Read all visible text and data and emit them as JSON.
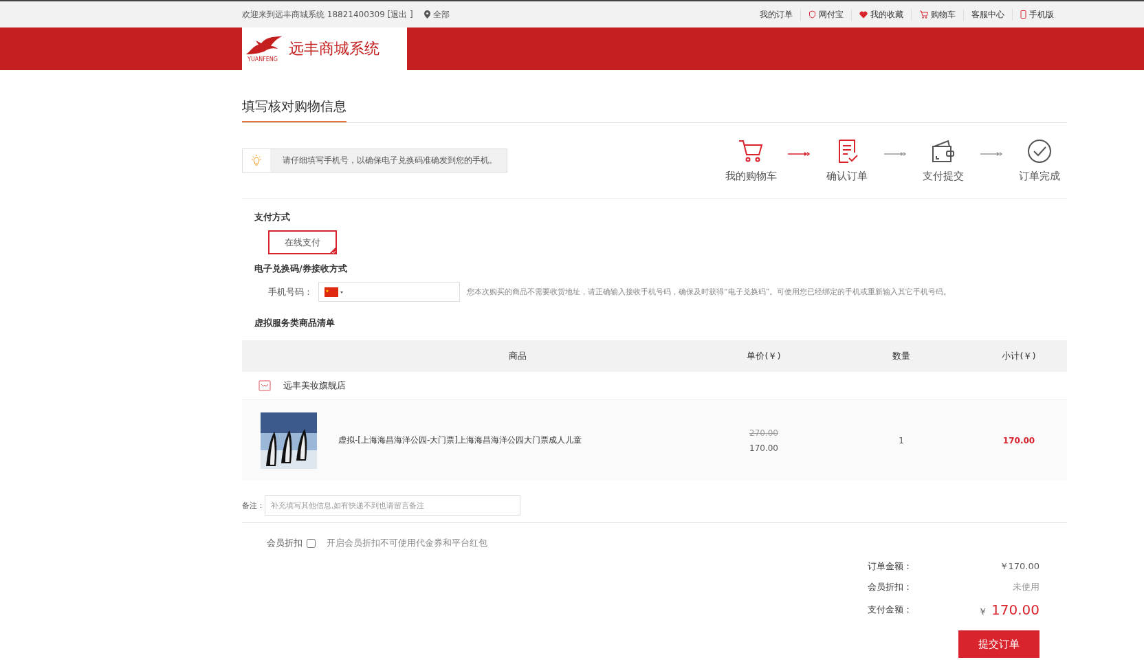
{
  "topbar": {
    "welcome": "欢迎来到远丰商城系统 18821400309 [退出 ]",
    "location": "全部",
    "links": [
      {
        "label": "我的订单",
        "kind": "plain"
      },
      {
        "label": "网付宝",
        "kind": "wallet"
      },
      {
        "label": "我的收藏",
        "kind": "favorites"
      },
      {
        "label": "购物车",
        "kind": "cart"
      },
      {
        "label": "客服中心",
        "kind": "plain"
      },
      {
        "label": "手机版",
        "kind": "mobile"
      }
    ]
  },
  "header": {
    "logo_text": "远丰商城系统",
    "logo_sub": "YUANFENG"
  },
  "page_title": "填写核对购物信息",
  "notice": "请仔细填写手机号，以确保电子兑换码准确发到您的手机。",
  "steps": [
    {
      "label": "我的购物车",
      "kind": "cart",
      "active": true
    },
    {
      "label": "确认订单",
      "kind": "confirm",
      "active": true
    },
    {
      "label": "支付提交",
      "kind": "pay",
      "active": false
    },
    {
      "label": "订单完成",
      "kind": "done",
      "active": false
    }
  ],
  "payment": {
    "title": "支付方式",
    "options": [
      {
        "label": "在线支付",
        "selected": true
      }
    ]
  },
  "receive": {
    "title": "电子兑换码/券接收方式",
    "phone_label": "手机号码：",
    "hint": "您本次购买的商品不需要收货地址，请正确输入接收手机号码，确保及时获得“电子兑换码”。可使用您已经绑定的手机或重新输入其它手机号码。"
  },
  "list_title": "虚拟服务类商品清单",
  "table": {
    "columns": [
      "商品",
      "单价(￥)",
      "数量",
      "小计(￥)"
    ],
    "store": "远丰美妆旗舰店",
    "rows": [
      {
        "name": "虚拟-[上海海昌海洋公园-大门票]上海海昌海洋公园大门票成人儿童",
        "old_price": "270.00",
        "price": "170.00",
        "qty": "1",
        "subtotal": "170.00"
      }
    ]
  },
  "note": {
    "label": "备注：",
    "placeholder": "补充填写其他信息,如有快递不到也请留言备注"
  },
  "member": {
    "label": "会员折扣",
    "checked": false,
    "hint": "开启会员折扣不可使用代金券和平台红包"
  },
  "totals": {
    "order_label": "订单金额：",
    "order_value": "￥170.00",
    "discount_label": "会员折扣：",
    "discount_value": "未使用",
    "pay_label": "支付金额：",
    "pay_currency": "￥",
    "pay_value": "170.00"
  },
  "submit": "提交订单"
}
